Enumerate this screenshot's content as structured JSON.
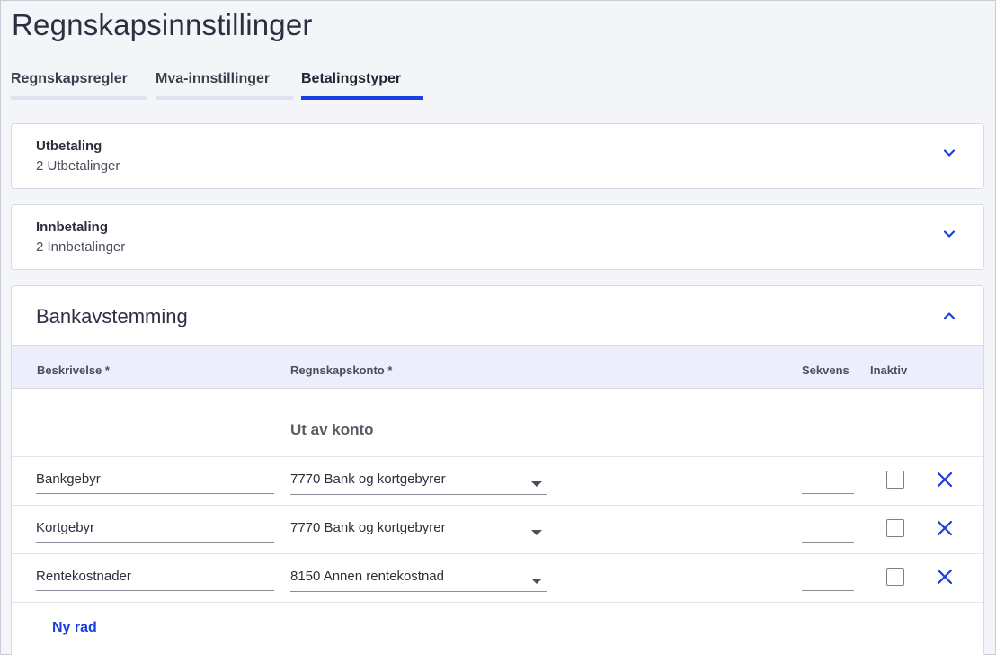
{
  "page": {
    "title": "Regnskapsinnstillinger"
  },
  "tabs": [
    {
      "label": "Regnskapsregler"
    },
    {
      "label": "Mva-innstillinger"
    },
    {
      "label": "Betalingstyper",
      "active": true
    }
  ],
  "sections": {
    "utbetaling": {
      "title": "Utbetaling",
      "subtitle": "2 Utbetalinger",
      "icon": "chevron-down-icon"
    },
    "innbetaling": {
      "title": "Innbetaling",
      "subtitle": "2 Innbetalinger",
      "icon": "chevron-down-icon"
    },
    "bankavstemming": {
      "title": "Bankavstemming",
      "icon": "chevron-up-icon",
      "columns": {
        "description": "Beskrivelse *",
        "account": "Regnskapskonto *",
        "sequence": "Sekvens",
        "inactive": "Inaktiv"
      },
      "group_label": "Ut av konto",
      "rows": [
        {
          "description": "Bankgebyr",
          "account": "7770 Bank og kortgebyrer",
          "sequence": "",
          "inactive": false
        },
        {
          "description": "Kortgebyr",
          "account": "7770 Bank og kortgebyrer",
          "sequence": "",
          "inactive": false
        },
        {
          "description": "Rentekostnader",
          "account": "8150 Annen rentekostnad",
          "sequence": "",
          "inactive": false
        }
      ],
      "new_row_label": "Ny rad"
    }
  },
  "colors": {
    "accent": "#1a3fe0",
    "header_bg": "#eceffb",
    "page_bg": "#f4f5f9"
  }
}
